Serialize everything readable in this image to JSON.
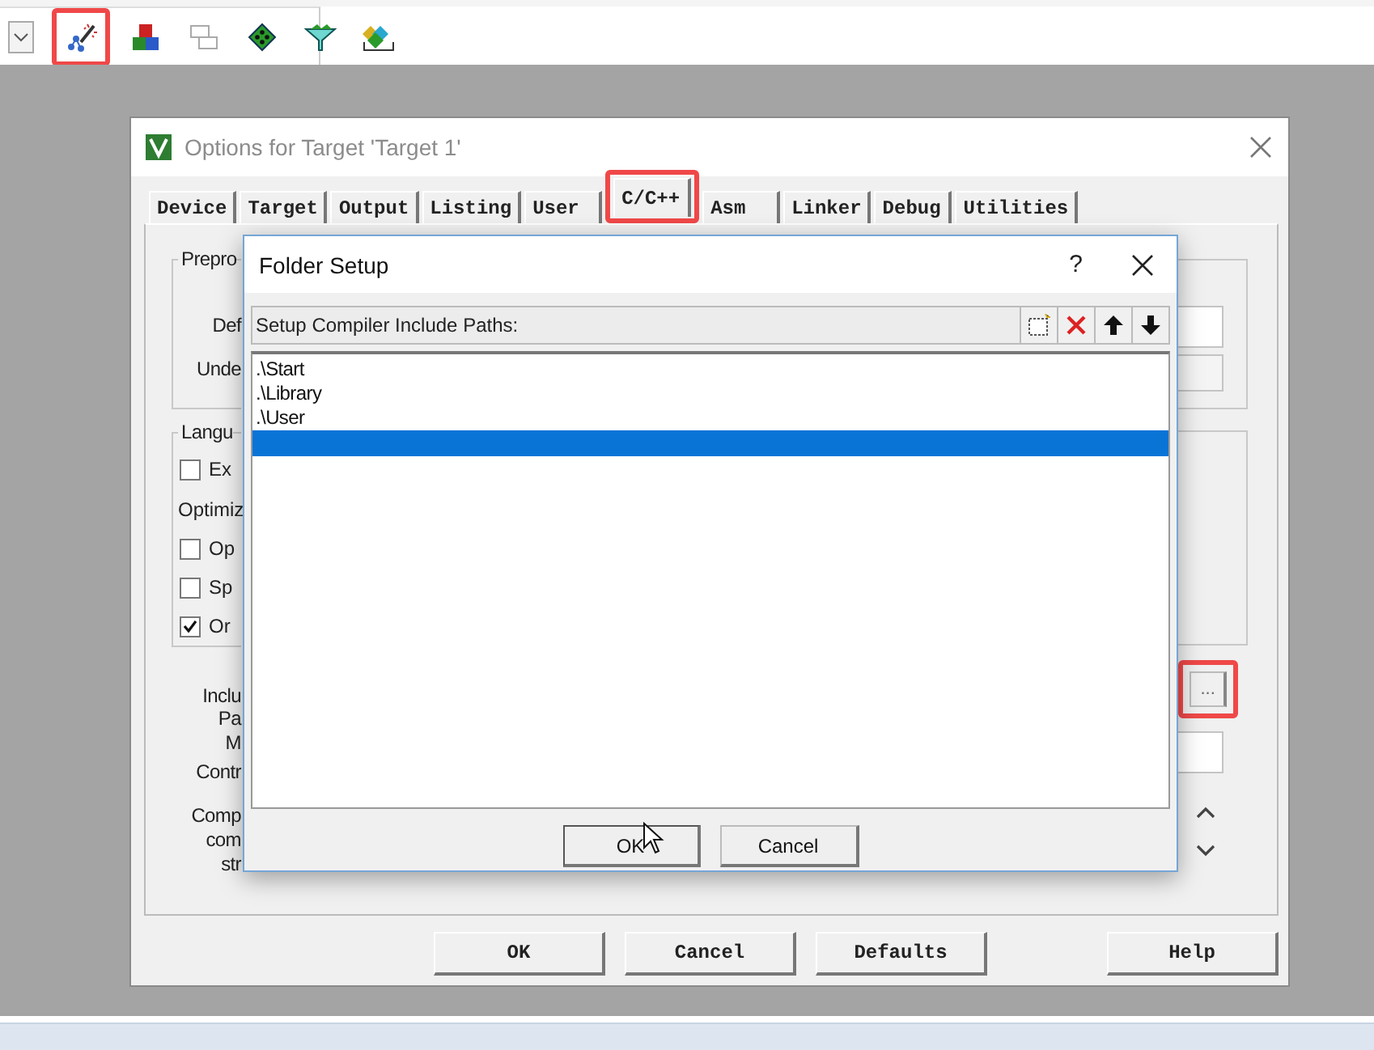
{
  "toolbar": {
    "tools": [
      {
        "kind": "dropdown",
        "highlighted": false
      },
      {
        "kind": "wand",
        "highlighted": true
      },
      {
        "kind": "blocks",
        "highlighted": false
      },
      {
        "kind": "windows",
        "highlighted": false
      },
      {
        "kind": "diamond",
        "highlighted": false
      },
      {
        "kind": "funnel",
        "highlighted": false
      },
      {
        "kind": "stack",
        "highlighted": false
      }
    ]
  },
  "options_dialog": {
    "title": "Options for Target 'Target 1'",
    "tabs": [
      {
        "label": "Device",
        "selected": false,
        "highlighted": false
      },
      {
        "label": "Target",
        "selected": false,
        "highlighted": false
      },
      {
        "label": "Output",
        "selected": false,
        "highlighted": false
      },
      {
        "label": "Listing",
        "selected": false,
        "highlighted": false
      },
      {
        "label": "User",
        "selected": false,
        "highlighted": false
      },
      {
        "label": "C/C++",
        "selected": true,
        "highlighted": true
      },
      {
        "label": "Asm",
        "selected": false,
        "highlighted": false
      },
      {
        "label": "Linker",
        "selected": false,
        "highlighted": false
      },
      {
        "label": "Debug",
        "selected": false,
        "highlighted": false
      },
      {
        "label": "Utilities",
        "selected": false,
        "highlighted": false
      }
    ],
    "preprocessor": {
      "title": "Prepro",
      "labels": [
        "Def",
        "Unde"
      ]
    },
    "language": {
      "title": "Langu",
      "checkboxes": [
        {
          "label": "Ex",
          "checked": false
        }
      ],
      "optimize_label": "Optimiz",
      "options": [
        {
          "label": "Op",
          "checked": false
        },
        {
          "label": "Sp",
          "checked": false
        },
        {
          "label": "Or",
          "checked": true
        }
      ]
    },
    "field_labels": [
      [
        "Inclu",
        "Pa"
      ],
      [
        "M",
        "Contr"
      ],
      [
        "Comp",
        "com",
        "str"
      ]
    ],
    "browse_button": {
      "label": "...",
      "highlighted": true
    },
    "buttons": [
      "OK",
      "Cancel",
      "Defaults",
      "Help"
    ]
  },
  "folder_setup": {
    "title": "Folder Setup",
    "help": "?",
    "header": "Setup Compiler Include Paths:",
    "paths": [
      {
        "text": ".\\Start",
        "selected": false
      },
      {
        "text": ".\\Library",
        "selected": false
      },
      {
        "text": ".\\User",
        "selected": false
      },
      {
        "selected": true
      }
    ],
    "buttons": [
      "OK",
      "Cancel"
    ]
  }
}
